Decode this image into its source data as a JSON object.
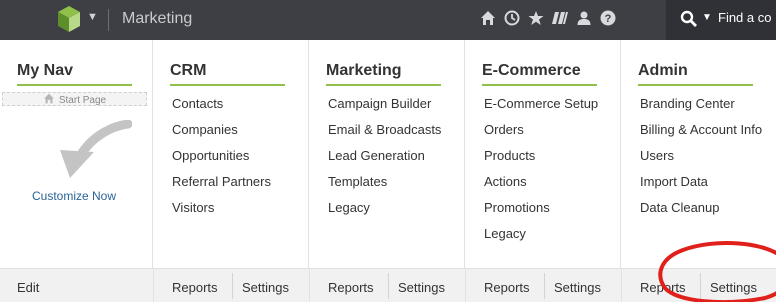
{
  "header": {
    "app_title": "Marketing",
    "icons": [
      "home-icon",
      "clock-icon",
      "star-icon",
      "puzzle-icon",
      "user-icon",
      "help-icon"
    ],
    "search_placeholder": "Find a co"
  },
  "columns": [
    {
      "title": "My Nav",
      "start_page_label": "Start Page",
      "customize_label": "Customize Now",
      "footer": [
        "Edit"
      ]
    },
    {
      "title": "CRM",
      "items": [
        "Contacts",
        "Companies",
        "Opportunities",
        "Referral Partners",
        "Visitors"
      ],
      "footer": [
        "Reports",
        "Settings"
      ]
    },
    {
      "title": "Marketing",
      "items": [
        "Campaign Builder",
        "Email & Broadcasts",
        "Lead Generation",
        "Templates",
        "Legacy"
      ],
      "footer": [
        "Reports",
        "Settings"
      ]
    },
    {
      "title": "E-Commerce",
      "items": [
        "E-Commerce Setup",
        "Orders",
        "Products",
        "Actions",
        "Promotions",
        "Legacy"
      ],
      "footer": [
        "Reports",
        "Settings"
      ]
    },
    {
      "title": "Admin",
      "items": [
        "Branding Center",
        "Billing & Account Info",
        "Users",
        "Import Data",
        "Data Cleanup"
      ],
      "footer": [
        "Reports",
        "Settings"
      ]
    }
  ],
  "colors": {
    "topbar": "#3d3f45",
    "accent_rule": "#8fc04a",
    "link": "#2a6496",
    "annotation": "#e0201b"
  }
}
